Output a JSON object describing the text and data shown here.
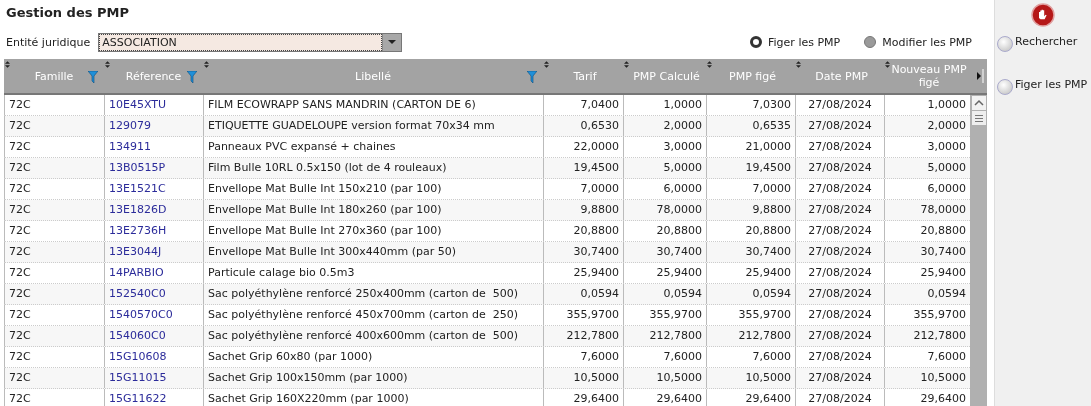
{
  "title": "Gestion des PMP",
  "entity": {
    "label": "Entité juridique",
    "value": "ASSOCIATION"
  },
  "modes": [
    {
      "label": "Figer les PMP",
      "selected": true
    },
    {
      "label": "Modifier les PMP",
      "selected": false
    }
  ],
  "table": {
    "columns": [
      {
        "label": "Famille",
        "filter": true
      },
      {
        "label": "Réference",
        "filter": true
      },
      {
        "label": "Libellé",
        "filter": true
      },
      {
        "label": "Tarif",
        "filter": false
      },
      {
        "label": "PMP Calculé",
        "filter": false
      },
      {
        "label": "PMP figé",
        "filter": false
      },
      {
        "label": "Date PMP",
        "filter": false
      },
      {
        "label": "Nouveau PMP figé",
        "filter": false
      }
    ],
    "rows": [
      [
        "72C",
        "10E45XTU",
        "FILM ECOWRAPP SANS MANDRIN (CARTON DE 6)",
        "7,0400",
        "1,0000",
        "7,0300",
        "27/08/2024",
        "1,0000"
      ],
      [
        "72C",
        "129079",
        "ETIQUETTE GUADELOUPE version format 70x34 mm",
        "0,6530",
        "2,0000",
        "0,6535",
        "27/08/2024",
        "2,0000"
      ],
      [
        "72C",
        "134911",
        "Panneaux PVC expansé + chaines",
        "22,0000",
        "3,0000",
        "21,0000",
        "27/08/2024",
        "3,0000"
      ],
      [
        "72C",
        "13B0515P",
        "Film Bulle 10RL 0.5x150 (lot de 4 rouleaux)",
        "19,4500",
        "5,0000",
        "19,4500",
        "27/08/2024",
        "5,0000"
      ],
      [
        "72C",
        "13E1521C",
        "Envellope Mat Bulle Int 150x210 (par 100)",
        "7,0000",
        "6,0000",
        "7,0000",
        "27/08/2024",
        "6,0000"
      ],
      [
        "72C",
        "13E1826D",
        "Envellope Mat Bulle Int 180x260 (par 100)",
        "9,8800",
        "78,0000",
        "9,8800",
        "27/08/2024",
        "78,0000"
      ],
      [
        "72C",
        "13E2736H",
        "Envellope Mat Bulle Int 270x360 (par 100)",
        "20,8800",
        "20,8800",
        "20,8800",
        "27/08/2024",
        "20,8800"
      ],
      [
        "72C",
        "13E3044J",
        "Envellope Mat Bulle Int 300x440mm (par 50)",
        "30,7400",
        "30,7400",
        "30,7400",
        "27/08/2024",
        "30,7400"
      ],
      [
        "72C",
        "14PARBIO",
        "Particule calage bio 0.5m3",
        "25,9400",
        "25,9400",
        "25,9400",
        "27/08/2024",
        "25,9400"
      ],
      [
        "72C",
        "152540C0",
        "Sac polyéthylène renforcé 250x400mm (carton de  500)",
        "0,0594",
        "0,0594",
        "0,0594",
        "27/08/2024",
        "0,0594"
      ],
      [
        "72C",
        "1540570C0",
        "Sac polyéthylène renforcé 450x700mm (carton de  250)",
        "355,9700",
        "355,9700",
        "355,9700",
        "27/08/2024",
        "355,9700"
      ],
      [
        "72C",
        "154060C0",
        "Sac polyéthylène renforcé 400x600mm (carton de  500)",
        "212,7800",
        "212,7800",
        "212,7800",
        "27/08/2024",
        "212,7800"
      ],
      [
        "72C",
        "15G10608",
        "Sachet Grip 60x80 (par 1000)",
        "7,6000",
        "7,6000",
        "7,6000",
        "27/08/2024",
        "7,6000"
      ],
      [
        "72C",
        "15G11015",
        "Sachet Grip 100x150mm (par 1000)",
        "10,5000",
        "10,5000",
        "10,5000",
        "27/08/2024",
        "10,5000"
      ],
      [
        "72C",
        "15G11622",
        "Sachet Grip 160X220mm (par 1000)",
        "29,6400",
        "29,6400",
        "29,6400",
        "27/08/2024",
        "29,6400"
      ]
    ]
  },
  "sidebar": {
    "buttons": [
      "Rechercher",
      "Figer les PMP"
    ]
  }
}
